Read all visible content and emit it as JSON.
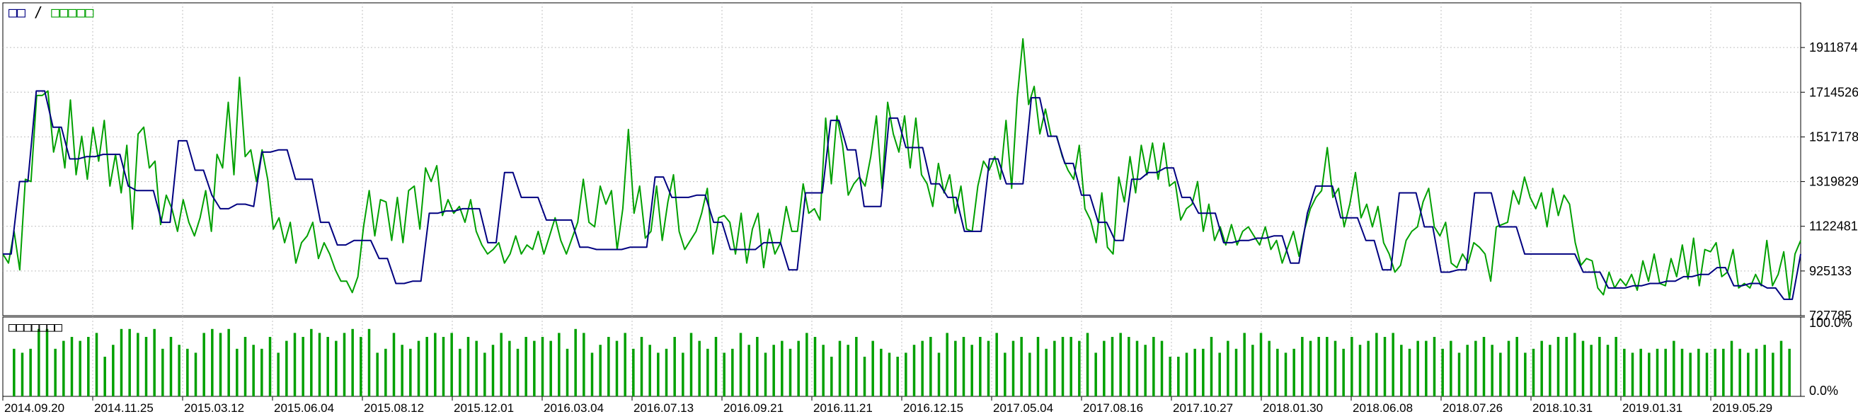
{
  "window": {
    "top_title_left": "□□",
    "top_title_sep": " / ",
    "top_title_right": "□□□□□",
    "bottom_title": "□□□□□□□"
  },
  "colors": {
    "background": "#ffffff",
    "frame": "#000000",
    "grid": "#c0c0c0",
    "series_primary": "#000080",
    "series_secondary": "#00a000",
    "bars": "#00a000",
    "top_title_left_color": "#000080",
    "top_title_right_color": "#00a000",
    "axis_text": "#000000"
  },
  "chart_data": [
    {
      "type": "line",
      "title": "",
      "ylim": [
        727785,
        2109222
      ],
      "yticks": [
        {
          "value": 1911874,
          "label": "1911874"
        },
        {
          "value": 1714526,
          "label": "1714526"
        },
        {
          "value": 1517178,
          "label": "1517178"
        },
        {
          "value": 1319829,
          "label": "1319829"
        },
        {
          "value": 1122481,
          "label": "1122481"
        },
        {
          "value": 925133,
          "label": "925133"
        },
        {
          "value": 727785,
          "label": "727785"
        }
      ],
      "series": [
        {
          "values": [
            1000000,
            1000000,
            1320000,
            1320000,
            1720000,
            1720000,
            1560000,
            1560000,
            1420000,
            1420000,
            1430000,
            1430000,
            1440000,
            1440000,
            1440000,
            1300000,
            1280000,
            1280000,
            1280000,
            1140000,
            1140000,
            1500000,
            1500000,
            1370000,
            1370000,
            1260000,
            1200000,
            1200000,
            1220000,
            1220000,
            1210000,
            1450000,
            1450000,
            1460000,
            1460000,
            1330000,
            1330000,
            1330000,
            1140000,
            1140000,
            1040000,
            1040000,
            1060000,
            1060000,
            1060000,
            980000,
            980000,
            870000,
            870000,
            880000,
            880000,
            1180000,
            1180000,
            1190000,
            1190000,
            1200000,
            1200000,
            1200000,
            1050000,
            1050000,
            1360000,
            1360000,
            1250000,
            1250000,
            1250000,
            1150000,
            1150000,
            1150000,
            1150000,
            1030000,
            1030000,
            1020000,
            1020000,
            1020000,
            1020000,
            1030000,
            1030000,
            1030000,
            1340000,
            1340000,
            1250000,
            1250000,
            1250000,
            1260000,
            1260000,
            1140000,
            1140000,
            1020000,
            1020000,
            1020000,
            1020000,
            1050000,
            1050000,
            1050000,
            930000,
            930000,
            1270000,
            1270000,
            1270000,
            1590000,
            1590000,
            1460000,
            1460000,
            1210000,
            1210000,
            1210000,
            1600000,
            1600000,
            1470000,
            1470000,
            1470000,
            1310000,
            1310000,
            1250000,
            1250000,
            1100000,
            1100000,
            1100000,
            1420000,
            1420000,
            1310000,
            1310000,
            1310000,
            1690000,
            1690000,
            1520000,
            1520000,
            1400000,
            1400000,
            1260000,
            1260000,
            1140000,
            1140000,
            1060000,
            1060000,
            1330000,
            1330000,
            1360000,
            1360000,
            1380000,
            1380000,
            1250000,
            1250000,
            1180000,
            1180000,
            1180000,
            1050000,
            1050000,
            1060000,
            1060000,
            1070000,
            1070000,
            1080000,
            1080000,
            960000,
            960000,
            1180000,
            1300000,
            1300000,
            1300000,
            1160000,
            1160000,
            1160000,
            1060000,
            1060000,
            930000,
            930000,
            1270000,
            1270000,
            1270000,
            1120000,
            1120000,
            920000,
            920000,
            930000,
            930000,
            1270000,
            1270000,
            1270000,
            1120000,
            1120000,
            1120000,
            1000000,
            1000000,
            1000000,
            1000000,
            1000000,
            1000000,
            1000000,
            920000,
            920000,
            920000,
            850000,
            850000,
            850000,
            860000,
            860000,
            870000,
            870000,
            880000,
            880000,
            900000,
            900000,
            910000,
            910000,
            940000,
            940000,
            860000,
            860000,
            870000,
            870000,
            850000,
            850000,
            800000,
            800000,
            1000000
          ]
        },
        {
          "values": [
            1000000,
            960000,
            1100000,
            930000,
            1330000,
            1320000,
            1700000,
            1700000,
            1720000,
            1450000,
            1560000,
            1380000,
            1680000,
            1350000,
            1520000,
            1330000,
            1560000,
            1410000,
            1590000,
            1300000,
            1440000,
            1270000,
            1480000,
            1110000,
            1530000,
            1560000,
            1380000,
            1410000,
            1130000,
            1260000,
            1200000,
            1100000,
            1240000,
            1140000,
            1080000,
            1160000,
            1280000,
            1100000,
            1440000,
            1380000,
            1670000,
            1350000,
            1780000,
            1430000,
            1460000,
            1320000,
            1460000,
            1330000,
            1110000,
            1160000,
            1050000,
            1140000,
            960000,
            1050000,
            1080000,
            1140000,
            980000,
            1050000,
            1000000,
            930000,
            880000,
            880000,
            830000,
            900000,
            1120000,
            1280000,
            1080000,
            1240000,
            1230000,
            1060000,
            1250000,
            1050000,
            1280000,
            1300000,
            1110000,
            1380000,
            1320000,
            1390000,
            1170000,
            1240000,
            1180000,
            1210000,
            1140000,
            1240000,
            1100000,
            1040000,
            1000000,
            1020000,
            1050000,
            960000,
            1000000,
            1080000,
            1000000,
            1040000,
            1020000,
            1100000,
            1000000,
            1080000,
            1160000,
            1060000,
            1000000,
            1070000,
            1140000,
            1330000,
            1140000,
            1120000,
            1300000,
            1220000,
            1280000,
            1020000,
            1200000,
            1550000,
            1180000,
            1300000,
            1070000,
            1100000,
            1300000,
            1060000,
            1230000,
            1350000,
            1100000,
            1020000,
            1060000,
            1100000,
            1180000,
            1290000,
            1000000,
            1160000,
            1170000,
            1140000,
            1000000,
            1180000,
            960000,
            1110000,
            1180000,
            940000,
            1110000,
            1000000,
            1050000,
            1210000,
            1100000,
            1100000,
            1310000,
            1180000,
            1200000,
            1150000,
            1600000,
            1310000,
            1610000,
            1480000,
            1260000,
            1310000,
            1340000,
            1300000,
            1430000,
            1610000,
            1290000,
            1670000,
            1530000,
            1450000,
            1610000,
            1380000,
            1600000,
            1350000,
            1310000,
            1210000,
            1400000,
            1270000,
            1350000,
            1180000,
            1300000,
            1110000,
            1100000,
            1300000,
            1410000,
            1370000,
            1430000,
            1330000,
            1590000,
            1290000,
            1690000,
            1950000,
            1660000,
            1740000,
            1530000,
            1640000,
            1520000,
            1520000,
            1430000,
            1370000,
            1330000,
            1480000,
            1200000,
            1150000,
            1050000,
            1270000,
            1030000,
            1000000,
            1340000,
            1230000,
            1430000,
            1270000,
            1480000,
            1350000,
            1490000,
            1330000,
            1490000,
            1300000,
            1320000,
            1150000,
            1200000,
            1220000,
            1320000,
            1100000,
            1220000,
            1060000,
            1120000,
            1040000,
            1130000,
            1040000,
            1100000,
            1120000,
            1080000,
            1040000,
            1120000,
            1020000,
            1060000,
            960000,
            1030000,
            1100000,
            990000,
            1110000,
            1200000,
            1250000,
            1280000,
            1470000,
            1250000,
            1290000,
            1120000,
            1220000,
            1360000,
            1160000,
            1220000,
            1120000,
            1210000,
            1050000,
            1000000,
            920000,
            950000,
            1060000,
            1100000,
            1120000,
            1230000,
            1290000,
            1120000,
            1080000,
            1140000,
            960000,
            940000,
            1000000,
            960000,
            1050000,
            1030000,
            1000000,
            880000,
            1120000,
            1130000,
            1140000,
            1280000,
            1220000,
            1340000,
            1250000,
            1200000,
            1270000,
            1120000,
            1290000,
            1170000,
            1260000,
            1220000,
            1050000,
            950000,
            980000,
            970000,
            850000,
            820000,
            920000,
            850000,
            890000,
            860000,
            910000,
            840000,
            970000,
            880000,
            1000000,
            870000,
            860000,
            980000,
            900000,
            1040000,
            890000,
            1070000,
            860000,
            1020000,
            1010000,
            1050000,
            900000,
            920000,
            1020000,
            850000,
            870000,
            850000,
            910000,
            860000,
            1060000,
            860000,
            910000,
            1010000,
            800000,
            1000000,
            1060000
          ]
        }
      ]
    },
    {
      "type": "bar",
      "title": "",
      "ylim": [
        0,
        100
      ],
      "yticks": [
        {
          "value": 100,
          "label": "100.0%"
        },
        {
          "value": 0,
          "label": "0.0%"
        }
      ],
      "categories": [
        "2014.09.20",
        "2014.11.25",
        "2015.03.12",
        "2015.06.04",
        "2015.08.12",
        "2015.12.01",
        "2016.03.04",
        "2016.07.13",
        "2016.09.21",
        "2016.11.21",
        "2016.12.15",
        "2017.05.04",
        "2017.08.16",
        "2017.10.27",
        "2018.01.30",
        "2018.06.08",
        "2018.07.26",
        "2018.10.31",
        "2019.01.31",
        "2019.05.29"
      ],
      "values": [
        60,
        55,
        60,
        85,
        85,
        60,
        70,
        75,
        70,
        75,
        80,
        50,
        65,
        85,
        85,
        80,
        75,
        85,
        60,
        75,
        65,
        60,
        55,
        80,
        85,
        80,
        85,
        60,
        75,
        65,
        60,
        75,
        55,
        70,
        80,
        75,
        85,
        80,
        75,
        70,
        80,
        85,
        75,
        85,
        55,
        60,
        80,
        65,
        60,
        70,
        75,
        80,
        75,
        80,
        60,
        75,
        70,
        55,
        65,
        80,
        70,
        60,
        75,
        70,
        75,
        70,
        80,
        60,
        85,
        80,
        55,
        65,
        75,
        70,
        80,
        60,
        75,
        65,
        55,
        60,
        75,
        55,
        80,
        70,
        60,
        75,
        55,
        60,
        80,
        65,
        75,
        55,
        65,
        70,
        60,
        70,
        80,
        75,
        65,
        50,
        70,
        65,
        75,
        50,
        70,
        60,
        55,
        50,
        55,
        65,
        70,
        75,
        55,
        80,
        70,
        75,
        65,
        75,
        70,
        80,
        55,
        70,
        75,
        55,
        75,
        60,
        70,
        75,
        75,
        70,
        80,
        55,
        70,
        75,
        80,
        75,
        70,
        65,
        75,
        70,
        50,
        50,
        55,
        60,
        60,
        75,
        55,
        70,
        60,
        80,
        65,
        80,
        70,
        60,
        55,
        60,
        75,
        70,
        75,
        75,
        70,
        60,
        75,
        65,
        70,
        80,
        75,
        80,
        65,
        60,
        70,
        70,
        75,
        60,
        70,
        55,
        65,
        70,
        75,
        65,
        55,
        70,
        75,
        55,
        60,
        70,
        65,
        75,
        75,
        80,
        70,
        65,
        75,
        65,
        75,
        60,
        55,
        60,
        55,
        60,
        60,
        70,
        60,
        55,
        60,
        55,
        60,
        60,
        70,
        60,
        55,
        60,
        65,
        55,
        70,
        60
      ]
    }
  ],
  "x_axis_labels": [
    "2014.09.20",
    "2014.11.25",
    "2015.03.12",
    "2015.06.04",
    "2015.08.12",
    "2015.12.01",
    "2016.03.04",
    "2016.07.13",
    "2016.09.21",
    "2016.11.21",
    "2016.12.15",
    "2017.05.04",
    "2017.08.16",
    "2017.10.27",
    "2018.01.30",
    "2018.06.08",
    "2018.07.26",
    "2018.10.31",
    "2019.01.31",
    "2019.05.29"
  ]
}
